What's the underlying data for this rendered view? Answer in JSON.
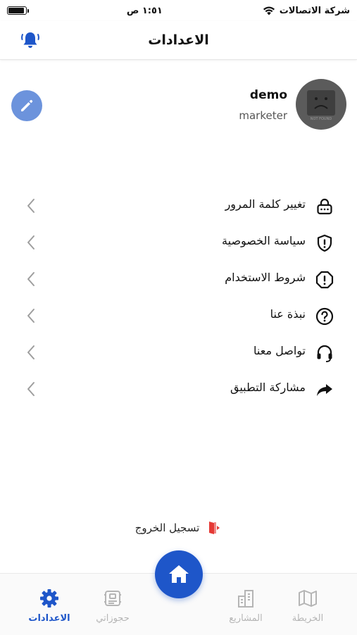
{
  "status_bar": {
    "carrier": "شركة الاتصالات",
    "time": "١:٥١ ص",
    "battery_level": 0.9
  },
  "header": {
    "title": "الاعدادات",
    "bell_icon": "bell-icon"
  },
  "profile": {
    "name": "demo",
    "role": "marketer",
    "avatar_text": "NOT FOUND",
    "edit_icon": "pencil-icon"
  },
  "menu": {
    "items": [
      {
        "label": "تغيير كلمة المرور",
        "icon": "lock-icon"
      },
      {
        "label": "سياسة الخصوصية",
        "icon": "shield-alert-icon"
      },
      {
        "label": "شروط الاستخدام",
        "icon": "octagon-alert-icon"
      },
      {
        "label": "نبذة عنا",
        "icon": "question-icon"
      },
      {
        "label": "تواصل معنا",
        "icon": "headset-icon"
      },
      {
        "label": "مشاركة التطبيق",
        "icon": "share-arrow-icon"
      }
    ]
  },
  "logout": {
    "label": "تسجيل الخروج",
    "icon": "logout-door-icon"
  },
  "bottom_nav": {
    "items": [
      {
        "label": "الاعدادات",
        "icon": "gear-icon",
        "active": true
      },
      {
        "label": "حجوزاتي",
        "icon": "bookings-icon",
        "active": false
      },
      {
        "label": "المشاريع",
        "icon": "buildings-icon",
        "active": false
      },
      {
        "label": "الخريطة",
        "icon": "map-icon",
        "active": false
      }
    ],
    "home_icon": "home-icon"
  },
  "colors": {
    "primary": "#1e56c9",
    "edit_button": "#6c93dc",
    "logout_icon": "#e53935",
    "inactive_nav": "#b5b5b5"
  }
}
